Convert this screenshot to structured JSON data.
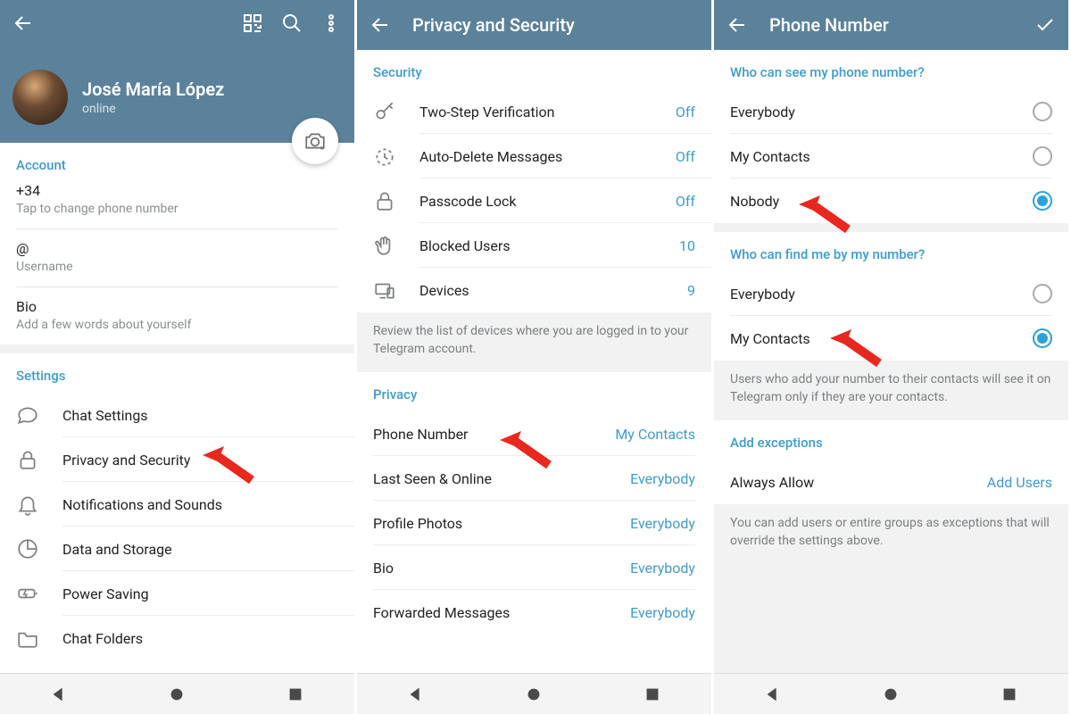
{
  "screen1": {
    "profile": {
      "name": "José María López",
      "status": "online"
    },
    "account": {
      "header": "Account",
      "phone": "+34",
      "phone_hint": "Tap to change phone number",
      "username": "@",
      "username_hint": "Username",
      "bio": "Bio",
      "bio_hint": "Add a few words about yourself"
    },
    "settings_header": "Settings",
    "settings": [
      "Chat Settings",
      "Privacy and Security",
      "Notifications and Sounds",
      "Data and Storage",
      "Power Saving",
      "Chat Folders"
    ]
  },
  "screen2": {
    "title": "Privacy and Security",
    "security_header": "Security",
    "security_items": [
      {
        "label": "Two-Step Verification",
        "value": "Off"
      },
      {
        "label": "Auto-Delete Messages",
        "value": "Off"
      },
      {
        "label": "Passcode Lock",
        "value": "Off"
      },
      {
        "label": "Blocked Users",
        "value": "10"
      },
      {
        "label": "Devices",
        "value": "9"
      }
    ],
    "devices_note": "Review the list of devices where you are logged in to your Telegram account.",
    "privacy_header": "Privacy",
    "privacy_items": [
      {
        "label": "Phone Number",
        "value": "My Contacts"
      },
      {
        "label": "Last Seen & Online",
        "value": "Everybody"
      },
      {
        "label": "Profile Photos",
        "value": "Everybody"
      },
      {
        "label": "Bio",
        "value": "Everybody"
      },
      {
        "label": "Forwarded Messages",
        "value": "Everybody"
      }
    ]
  },
  "screen3": {
    "title": "Phone Number",
    "q1_header": "Who can see my phone number?",
    "q1_options": [
      {
        "label": "Everybody",
        "selected": false
      },
      {
        "label": "My Contacts",
        "selected": false
      },
      {
        "label": "Nobody",
        "selected": true
      }
    ],
    "q2_header": "Who can find me by my number?",
    "q2_options": [
      {
        "label": "Everybody",
        "selected": false
      },
      {
        "label": "My Contacts",
        "selected": true
      }
    ],
    "q2_note": "Users who add your number to their contacts will see it on Telegram only if they are your contacts.",
    "exceptions_header": "Add exceptions",
    "exceptions_label": "Always Allow",
    "exceptions_value": "Add Users",
    "exceptions_note": "You can add users or entire groups as exceptions that will override the settings above."
  }
}
